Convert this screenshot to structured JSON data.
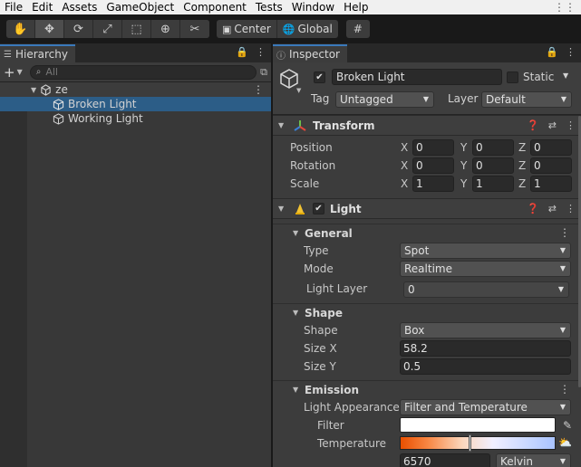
{
  "menu": [
    "File",
    "Edit",
    "Assets",
    "GameObject",
    "Component",
    "Tests",
    "Window",
    "Help"
  ],
  "toolbar": {
    "tools": [
      "hand-icon",
      "move-icon",
      "rotate-icon",
      "scale-icon",
      "rect-icon",
      "transform-icon",
      "custom-tool-icon"
    ],
    "pivot_label": "Center",
    "space_label": "Global"
  },
  "hierarchy": {
    "tab_label": "Hierarchy",
    "search_placeholder": "All",
    "scene_name": "ze",
    "items": [
      {
        "label": "Broken Light",
        "selected": true
      },
      {
        "label": "Working Light",
        "selected": false
      }
    ]
  },
  "inspector": {
    "tab_label": "Inspector",
    "object_name": "Broken Light",
    "static_label": "Static",
    "tag_label": "Tag",
    "tag_value": "Untagged",
    "layer_label": "Layer",
    "layer_value": "Default",
    "transform": {
      "title": "Transform",
      "rows": [
        {
          "label": "Position",
          "x": "0",
          "y": "0",
          "z": "0"
        },
        {
          "label": "Rotation",
          "x": "0",
          "y": "0",
          "z": "0"
        },
        {
          "label": "Scale",
          "x": "1",
          "y": "1",
          "z": "1"
        }
      ],
      "axis": {
        "x": "X",
        "y": "Y",
        "z": "Z"
      }
    },
    "light": {
      "title": "Light",
      "general": {
        "title": "General",
        "type_label": "Type",
        "type_value": "Spot",
        "mode_label": "Mode",
        "mode_value": "Realtime",
        "layer_label": "Light Layer",
        "layer_value": "0"
      },
      "shape": {
        "title": "Shape",
        "shape_label": "Shape",
        "shape_value": "Box",
        "sizex_label": "Size X",
        "sizex_value": "58.2",
        "sizey_label": "Size Y",
        "sizey_value": "0.5"
      },
      "emission": {
        "title": "Emission",
        "appearance_label": "Light Appearance",
        "appearance_value": "Filter and Temperature",
        "filter_label": "Filter",
        "temperature_label": "Temperature",
        "temperature_value": "6570",
        "unit_value": "Kelvin"
      }
    }
  },
  "colors": {
    "selection": "#2c5d87",
    "tab_accent": "#3a79bb",
    "filter_color": "#ffffff"
  }
}
